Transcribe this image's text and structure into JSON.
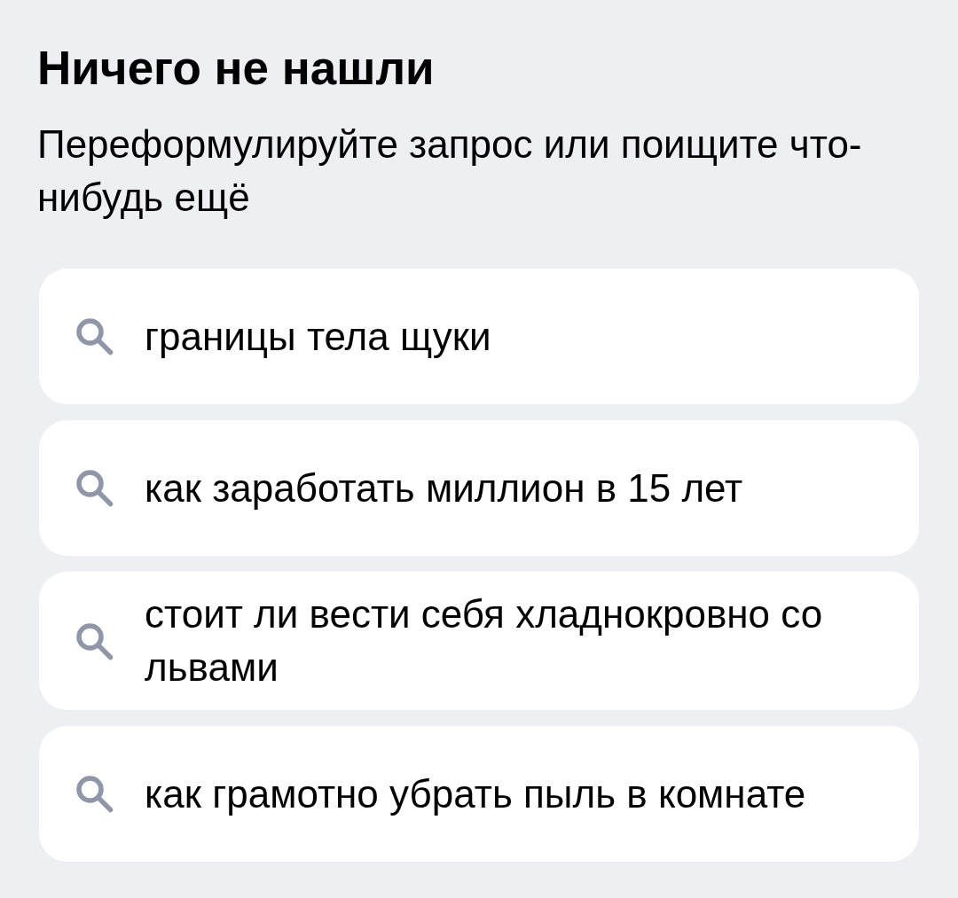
{
  "title": "Ничего не нашли",
  "subtitle": "Переформулируйте запрос или поищите что-нибудь ещё",
  "suggestions": [
    {
      "text": "границы тела щуки"
    },
    {
      "text": "как заработать миллион в 15 лет"
    },
    {
      "text": "стоит ли вести себя хладнокровно со львами"
    },
    {
      "text": "как грамотно убрать пыль в комнате"
    }
  ]
}
